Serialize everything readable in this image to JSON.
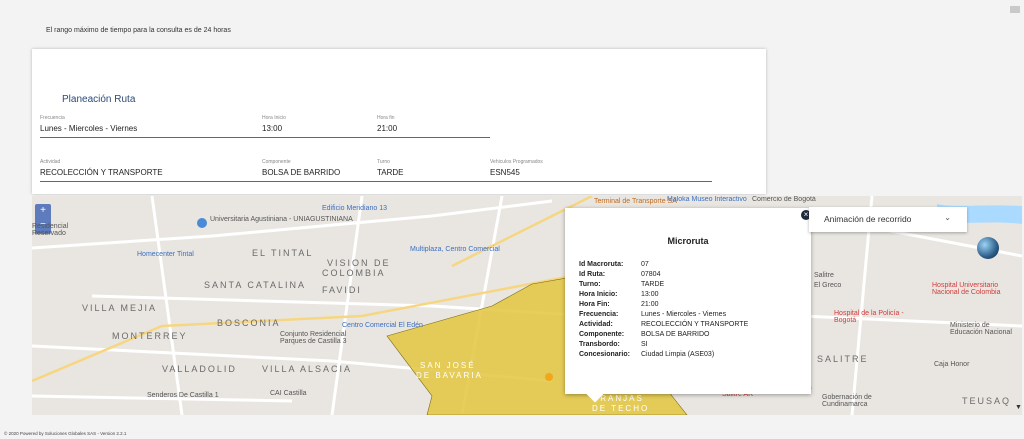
{
  "notice": "El rango máximo de tiempo para la consulta es de 24 horas",
  "planeacion": {
    "title": "Planeación Ruta",
    "frecuencia_label": "Frecuencia",
    "frecuencia": "Lunes - Miercoles - Viernes",
    "hora_inicio_label": "Hora Inicio",
    "hora_inicio": "13:00",
    "hora_fin_label": "Hora fin",
    "hora_fin": "21:00",
    "actividad_label": "Actividad",
    "actividad": "RECOLECCIÓN Y TRANSPORTE",
    "componente_label": "Componente",
    "componente": "BOLSA DE BARRIDO",
    "turno_label": "Turno",
    "turno": "TARDE",
    "vehiculos_label": "Vehiculos Programados",
    "vehiculos": "ESN545"
  },
  "map": {
    "zoom_in": "+",
    "zoom_out": "−",
    "animacion_label": "Animación de recorrido",
    "labels": [
      "Universitaria Agustiniana - UNIAGUSTINIANA",
      "Edificio Meridiano 13",
      "Homecenter Tintal",
      "EL TINTAL",
      "VISION DE",
      "COLOMBIA",
      "SANTA CATALINA",
      "FAVIDI",
      "VILLA MEJIA",
      "BOSCONIA",
      "MONTERREY",
      "Conjunto Residencial Parques de Castilla 3",
      "VALLADOLID",
      "VILLA ALSACIA",
      "Senderos De Castilla 1",
      "CAI Castilla",
      "Centro Comercial El Edén",
      "Multiplaza, Centro Comercial",
      "Terminal de Transporte SA",
      "Maloka Museo Interactivo",
      "Comercio de Bogotá",
      "Hospital de la Policía - Bogotá",
      "Hospital Universitario Nacional de Colombia",
      "Ministerio de Educación Nacional",
      "Caja Honor",
      "DoubleTree by Hilton Bogotá Salitre AR",
      "Gobernación de Cundinamarca",
      "TEUSAQ",
      "SALITRE",
      "SAN JOSÉ",
      "DE BAVARIA",
      "GRANJAS",
      "DE TECHO",
      "Residencial Reservado",
      "Salitre",
      "El Greco"
    ]
  },
  "popup": {
    "close": "×",
    "title": "Microruta",
    "rows": [
      {
        "k": "Id Macroruta:",
        "v": "07"
      },
      {
        "k": "Id Ruta:",
        "v": "07804"
      },
      {
        "k": "Turno:",
        "v": "TARDE"
      },
      {
        "k": "Hora Inicio:",
        "v": "13:00"
      },
      {
        "k": "Hora Fin:",
        "v": "21:00"
      },
      {
        "k": "Frecuencia:",
        "v": "Lunes - Miercoles - Viernes"
      },
      {
        "k": "Actividad:",
        "v": "RECOLECCIÓN Y TRANSPORTE"
      },
      {
        "k": "Componente:",
        "v": "BOLSA DE BARRIDO"
      },
      {
        "k": "Transbordo:",
        "v": "SI"
      },
      {
        "k": "Concesionario:",
        "v": "Ciudad Limpia (ASE03)"
      }
    ]
  },
  "footer": "© 2020 Powered by Soluciones Globales SAS - Version 2.2.1",
  "colors": {
    "route_fill": "#e3c63e",
    "title_blue": "#2b4a78",
    "water": "#aadaff"
  }
}
